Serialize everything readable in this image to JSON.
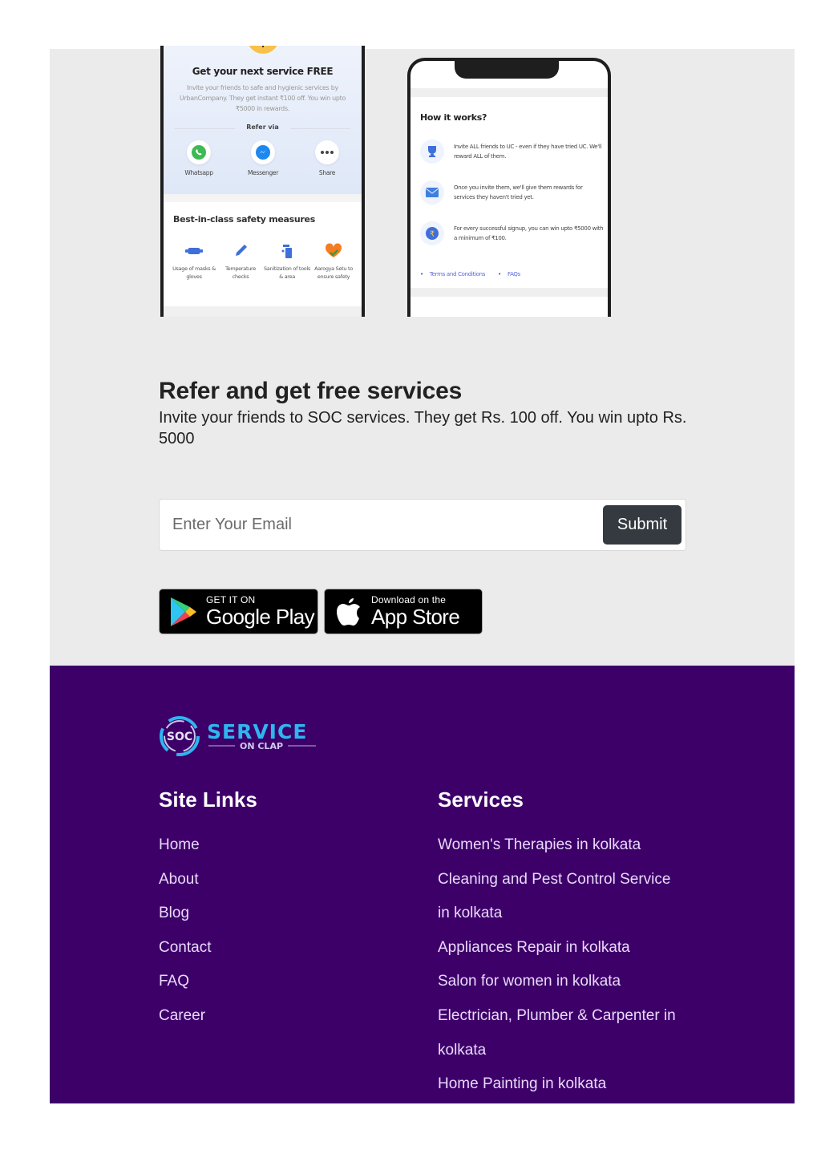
{
  "phone_mockups": {
    "left": {
      "title": "Get your next service FREE",
      "description": "Invite your friends to safe and hygienic services by UrbanCompany. They get instant ₹100 off. You win upto ₹5000 in rewards.",
      "refer_via_label": "Refer via",
      "share_options": [
        {
          "icon": "whatsapp-icon",
          "label": "Whatsapp"
        },
        {
          "icon": "messenger-icon",
          "label": "Messenger"
        },
        {
          "icon": "more-icon",
          "label": "Share"
        }
      ],
      "safety_title": "Best-in-class safety measures",
      "safety_items": [
        {
          "icon": "mask-icon",
          "label": "Usage of masks & gloves"
        },
        {
          "icon": "thermometer-icon",
          "label": "Temperature checks"
        },
        {
          "icon": "sanitizer-icon",
          "label": "Sanitization of tools & area"
        },
        {
          "icon": "heart-check-icon",
          "label": "Aarogya Setu to ensure safety"
        }
      ]
    },
    "right": {
      "title": "How it works?",
      "steps": [
        {
          "icon": "trophy-icon",
          "text": "Invite ALL friends to UC - even if they have tried UC. We'll reward ALL of them."
        },
        {
          "icon": "mail-icon",
          "text": "Once you invite them, we'll give them rewards for services they haven't tried yet."
        },
        {
          "icon": "rupee-icon",
          "text": "For every successful signup, you can win upto ₹5000 with a minimum of ₹100."
        }
      ],
      "links": [
        "Terms and Conditions",
        "FAQs"
      ]
    }
  },
  "refer": {
    "title": "Refer and get free services",
    "description": "Invite your friends to SOC services. They get Rs. 100 off. You win upto Rs. 5000",
    "email_placeholder": "Enter Your Email",
    "email_value": "",
    "submit_label": "Submit"
  },
  "store_badges": {
    "google_play": {
      "small": "GET IT ON",
      "large": "Google Play"
    },
    "app_store": {
      "small": "Download on the",
      "large": "App Store"
    }
  },
  "footer": {
    "logo": {
      "mark": "SOC",
      "name": "SERVICE",
      "tagline": "ON CLAP"
    },
    "site_links_title": "Site Links",
    "site_links": [
      "Home",
      "About",
      "Blog",
      "Contact",
      "FAQ",
      "Career"
    ],
    "services_title": "Services",
    "services_lines": [
      "Women's Therapies in kolkata",
      "Cleaning and Pest Control Service",
      "in kolkata",
      "Appliances Repair in kolkata",
      "Salon for women in kolkata",
      "Electrician, Plumber & Carpenter in",
      "kolkata",
      "Home Painting in kolkata"
    ]
  },
  "colors": {
    "section_bg": "#ebebeb",
    "footer_bg": "#3d0069",
    "submit_bg": "#343a40",
    "logo_accent": "#2fb5f0"
  }
}
